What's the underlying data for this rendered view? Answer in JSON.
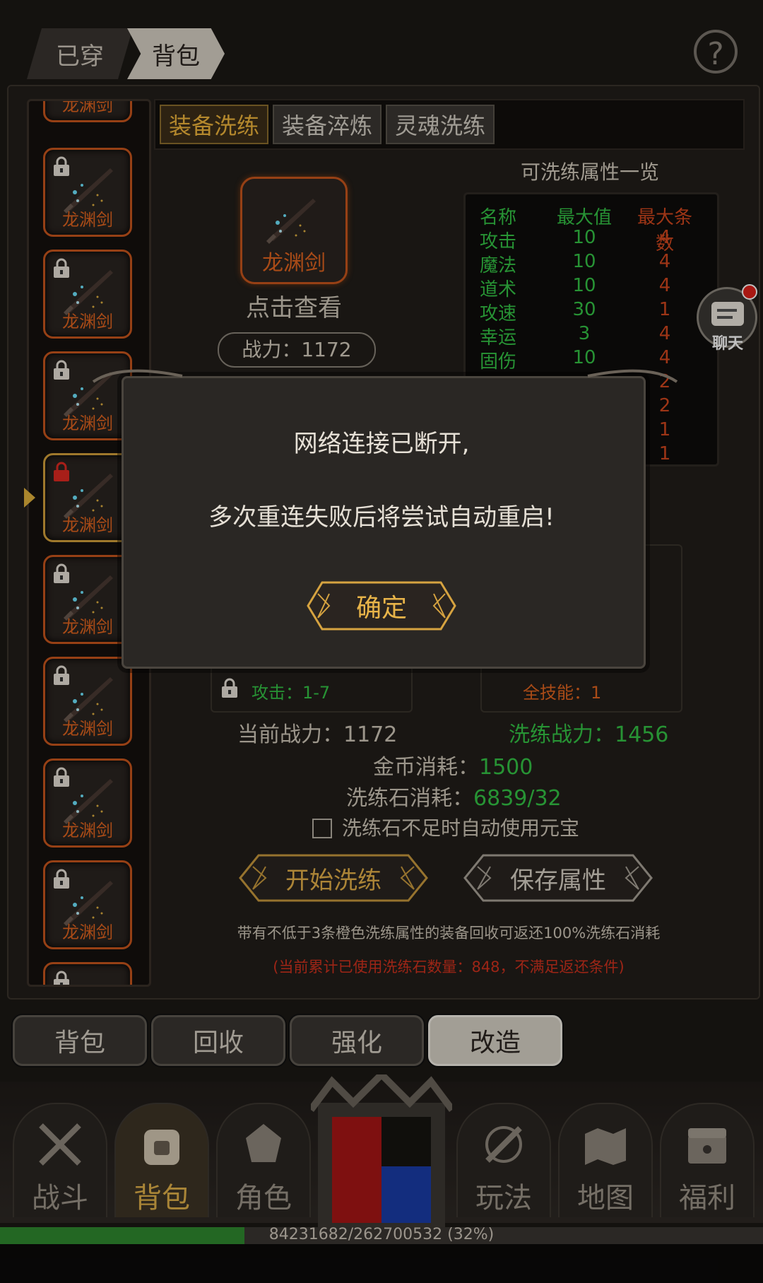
{
  "top_tabs": {
    "worn": "已穿",
    "bag": "背包"
  },
  "help_icon": "?",
  "item_list": {
    "name": "龙渊剑"
  },
  "sub_tabs": [
    "装备洗练",
    "装备淬炼",
    "灵魂洗练"
  ],
  "equip": {
    "name": "龙渊剑",
    "view_label": "点击查看",
    "power_label": "战力：1172"
  },
  "attr_table": {
    "title": "可洗练属性一览",
    "headers": {
      "name": "名称",
      "max": "最大值",
      "count": "最大条数"
    },
    "rows": [
      {
        "name": "攻击",
        "max": "10",
        "count": "4"
      },
      {
        "name": "魔法",
        "max": "10",
        "count": "4"
      },
      {
        "name": "道术",
        "max": "10",
        "count": "4"
      },
      {
        "name": "攻速",
        "max": "30",
        "count": "1"
      },
      {
        "name": "幸运",
        "max": "3",
        "count": "4"
      },
      {
        "name": "固伤",
        "max": "10",
        "count": "4"
      }
    ],
    "hidden_counts": [
      "2",
      "2",
      "1",
      "1"
    ]
  },
  "chat": {
    "label": "聊天"
  },
  "wash": {
    "left_attr": "攻击：1-7",
    "right_attr": "全技能：1",
    "current_power": "当前战力：1172",
    "wash_power": "洗练战力：1456",
    "gold_label": "金币消耗：",
    "gold_value": "1500",
    "stone_label": "洗练石消耗：",
    "stone_value": "6839/32",
    "auto_label": "洗练石不足时自动使用元宝",
    "start_button": "开始洗练",
    "save_button": "保存属性",
    "note": "带有不低于3条橙色洗练属性的装备回收可返还100%洗练石消耗",
    "note_red": "(当前累计已使用洗练石数量：848，不满足返还条件)"
  },
  "bottom_tabs": [
    "背包",
    "回收",
    "强化",
    "改造"
  ],
  "nav": [
    "战斗",
    "背包",
    "角色",
    "玩法",
    "地图",
    "福利"
  ],
  "xp": {
    "text": "84231682/262700532 (32%)",
    "fraction": 0.32
  },
  "dialog": {
    "line1": "网络连接已断开,",
    "line2": "多次重连失败后将尝试自动重启!",
    "confirm": "确定"
  },
  "colors": {
    "accent_gold": "#e6b24a",
    "green": "#34c446",
    "orange": "#e2651f",
    "red": "#d2321e"
  }
}
